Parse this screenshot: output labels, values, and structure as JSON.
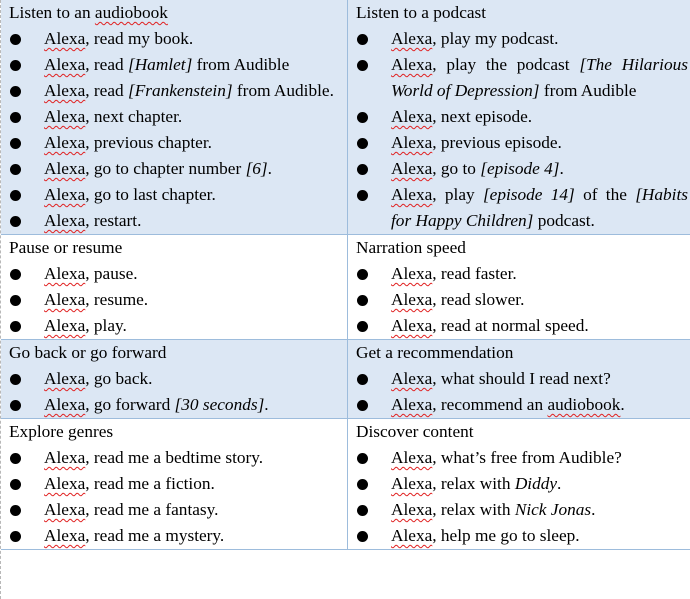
{
  "document": {
    "sections": [
      {
        "title_parts": [
          {
            "t": "Listen to an "
          },
          {
            "t": "audiobook",
            "sq": true
          }
        ],
        "items": [
          [
            {
              "t": "Alexa",
              "sq": true
            },
            {
              "t": ", read my book."
            }
          ],
          [
            {
              "t": "Alexa",
              "sq": true
            },
            {
              "t": ", read "
            },
            {
              "t": "[Hamlet]",
              "i": true
            },
            {
              "t": " from Audible"
            }
          ],
          [
            {
              "t": "Alexa",
              "sq": true
            },
            {
              "t": ", read "
            },
            {
              "t": "[Frankenstein]",
              "i": true
            },
            {
              "t": " from Audible."
            }
          ],
          [
            {
              "t": "Alexa",
              "sq": true
            },
            {
              "t": ", next chapter."
            }
          ],
          [
            {
              "t": "Alexa",
              "sq": true
            },
            {
              "t": ", previous chapter."
            }
          ],
          [
            {
              "t": "Alexa",
              "sq": true
            },
            {
              "t": ", go to chapter number "
            },
            {
              "t": "[6]",
              "i": true
            },
            {
              "t": "."
            }
          ],
          [
            {
              "t": "Alexa",
              "sq": true
            },
            {
              "t": ", go to last chapter."
            }
          ],
          [
            {
              "t": "Alexa",
              "sq": true
            },
            {
              "t": ", restart."
            }
          ]
        ]
      },
      {
        "title_parts": [
          {
            "t": "Listen to a podcast"
          }
        ],
        "items": [
          [
            {
              "t": "Alexa",
              "sq": true
            },
            {
              "t": ", play my podcast."
            }
          ],
          [
            {
              "t": "Alexa",
              "sq": true
            },
            {
              "t": ", play the podcast "
            },
            {
              "t": "[The Hilarious World of Depression]",
              "i": true
            },
            {
              "t": " from Audible"
            }
          ],
          [
            {
              "t": "Alexa",
              "sq": true
            },
            {
              "t": ", next episode."
            }
          ],
          [
            {
              "t": "Alexa",
              "sq": true
            },
            {
              "t": ", previous episode."
            }
          ],
          [
            {
              "t": "Alexa",
              "sq": true
            },
            {
              "t": ", go to "
            },
            {
              "t": "[episode 4]",
              "i": true
            },
            {
              "t": "."
            }
          ],
          [
            {
              "t": "Alexa",
              "sq": true
            },
            {
              "t": ", play "
            },
            {
              "t": "[episode 14]",
              "i": true
            },
            {
              "t": " of the "
            },
            {
              "t": "[Habits for Happy Children]",
              "i": true
            },
            {
              "t": " podcast."
            }
          ]
        ]
      },
      {
        "title_parts": [
          {
            "t": "Pause or resume"
          }
        ],
        "items": [
          [
            {
              "t": "Alexa",
              "sq": true
            },
            {
              "t": ", pause."
            }
          ],
          [
            {
              "t": "Alexa",
              "sq": true
            },
            {
              "t": ", resume."
            }
          ],
          [
            {
              "t": "Alexa",
              "sq": true
            },
            {
              "t": ", play."
            }
          ]
        ]
      },
      {
        "title_parts": [
          {
            "t": "Narration speed"
          }
        ],
        "items": [
          [
            {
              "t": "Alexa",
              "sq": true
            },
            {
              "t": ", read faster."
            }
          ],
          [
            {
              "t": "Alexa",
              "sq": true
            },
            {
              "t": ", read slower."
            }
          ],
          [
            {
              "t": "Alexa",
              "sq": true
            },
            {
              "t": ", read at normal speed."
            }
          ]
        ]
      },
      {
        "title_parts": [
          {
            "t": "Go back or go forward"
          }
        ],
        "items": [
          [
            {
              "t": "Alexa",
              "sq": true
            },
            {
              "t": ", go back."
            }
          ],
          [
            {
              "t": "Alexa",
              "sq": true
            },
            {
              "t": ", go forward "
            },
            {
              "t": "[30 seconds]",
              "i": true
            },
            {
              "t": "."
            }
          ]
        ]
      },
      {
        "title_parts": [
          {
            "t": "Get a recommendation"
          }
        ],
        "items": [
          [
            {
              "t": "Alexa",
              "sq": true
            },
            {
              "t": ", what should I read next?"
            }
          ],
          [
            {
              "t": "Alexa",
              "sq": true
            },
            {
              "t": ", recommend an "
            },
            {
              "t": "audiobook",
              "sq": true
            },
            {
              "t": "."
            }
          ]
        ]
      },
      {
        "title_parts": [
          {
            "t": "Explore genres"
          }
        ],
        "items": [
          [
            {
              "t": "Alexa",
              "sq": true
            },
            {
              "t": ", read me a bedtime story."
            }
          ],
          [
            {
              "t": "Alexa",
              "sq": true
            },
            {
              "t": ", read me a fiction."
            }
          ],
          [
            {
              "t": "Alexa",
              "sq": true
            },
            {
              "t": ", read me a fantasy."
            }
          ],
          [
            {
              "t": "Alexa",
              "sq": true
            },
            {
              "t": ", read me a mystery."
            }
          ]
        ]
      },
      {
        "title_parts": [
          {
            "t": "Discover content"
          }
        ],
        "items": [
          [
            {
              "t": "Alexa",
              "sq": true
            },
            {
              "t": ", what’s free from Audible?"
            }
          ],
          [
            {
              "t": "Alexa",
              "sq": true
            },
            {
              "t": ", relax with "
            },
            {
              "t": "Diddy",
              "i": true
            },
            {
              "t": "."
            }
          ],
          [
            {
              "t": "Alexa",
              "sq": true
            },
            {
              "t": ", relax with "
            },
            {
              "t": "Nick Jonas",
              "i": true
            },
            {
              "t": "."
            }
          ],
          [
            {
              "t": "Alexa",
              "sq": true
            },
            {
              "t": ", help me go to sleep."
            }
          ]
        ]
      }
    ],
    "colors": {
      "shaded_row": "#dce7f4",
      "border": "#9dbcdc",
      "spellcheck": "#e02020"
    }
  }
}
